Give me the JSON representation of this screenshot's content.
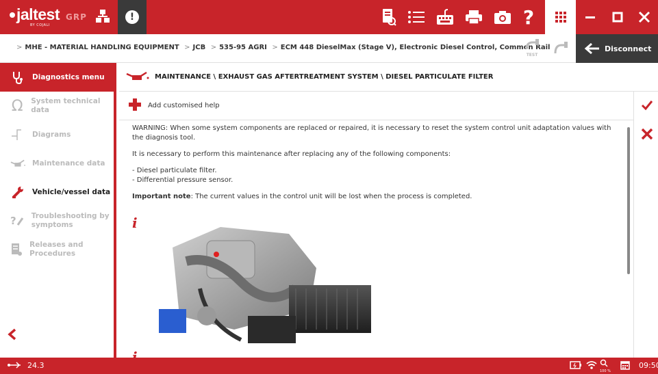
{
  "app": {
    "logo_text": "jaltest",
    "logo_sub": "BY COJALI",
    "group_label": "GRP"
  },
  "toolbar": {
    "icons": [
      "document-search-icon",
      "list-icon",
      "keyboard-icon",
      "printer-icon",
      "camera-icon",
      "help-icon",
      "apps-grid-icon"
    ],
    "window_controls": [
      "minimize-icon",
      "maximize-icon",
      "close-icon"
    ]
  },
  "breadcrumb": {
    "items": [
      "MHE - MATERIAL HANDLING EQUIPMENT",
      "JCB",
      "535-95 AGRI",
      "ECM 448 DieselMax (Stage V), Electronic Diesel Control, Common Rail"
    ],
    "test_label": "TEST",
    "disconnect_label": "Disconnect"
  },
  "sidebar": {
    "items": [
      {
        "label": "Diagnostics menu",
        "state": "active",
        "icon": "stethoscope-icon"
      },
      {
        "label": "System technical data",
        "state": "disabled",
        "icon": "omega-icon"
      },
      {
        "label": "Diagrams",
        "state": "disabled",
        "icon": "diagram-icon"
      },
      {
        "label": "Maintenance data",
        "state": "disabled",
        "icon": "oil-can-icon"
      },
      {
        "label": "Vehicle/vessel data",
        "state": "enabled",
        "icon": "wrench-icon"
      },
      {
        "label": "Troubleshooting by symptoms",
        "state": "disabled",
        "icon": "troubleshoot-icon"
      },
      {
        "label": "Releases and Procedures",
        "state": "disabled",
        "icon": "releases-icon"
      }
    ]
  },
  "content": {
    "path": "MAINTENANCE \\ EXHAUST GAS AFTERTREATMENT SYSTEM \\ DIESEL PARTICULATE FILTER",
    "add_help": "Add customised help",
    "warning": "WARNING: When some system components are replaced or repaired, it is necessary to reset the system control unit adaptation values with the diagnosis tool.",
    "intro": "It is necessary to perform this maintenance after replacing any of the following components:",
    "components": [
      "- Diesel particulate filter.",
      "- Differential pressure sensor."
    ],
    "note_label": "Important note",
    "note_text": ": The current values in the control unit will be lost when the process is completed."
  },
  "statusbar": {
    "voltage": "24.3",
    "zoom": "100 %",
    "time": "09:50"
  },
  "colors": {
    "brand_red": "#c8242a",
    "dark": "#3a3a3a"
  }
}
